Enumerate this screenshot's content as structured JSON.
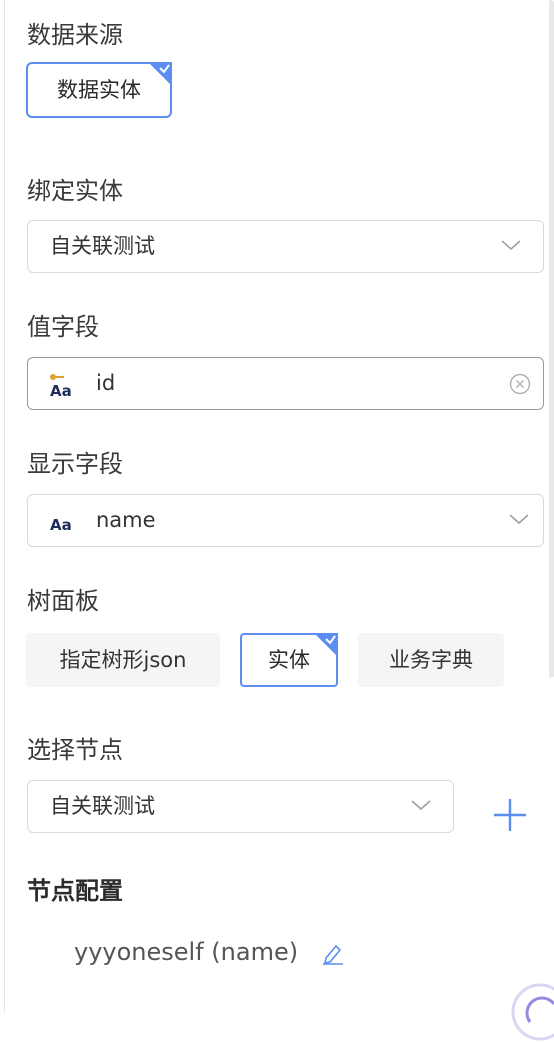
{
  "data_source": {
    "label": "数据来源",
    "option": "数据实体"
  },
  "bind_entity": {
    "label": "绑定实体",
    "value": "自关联测试"
  },
  "value_field": {
    "label": "值字段",
    "value": "id",
    "icon": "aa-key-icon"
  },
  "display_field": {
    "label": "显示字段",
    "value": "name",
    "icon": "aa-icon"
  },
  "tree_panel": {
    "label": "树面板",
    "options": [
      "指定树形json",
      "实体",
      "业务字典"
    ],
    "selected": "实体"
  },
  "select_node": {
    "label": "选择节点",
    "value": "自关联测试"
  },
  "node_config": {
    "label": "节点配置",
    "item": "yyyoneself (name)"
  },
  "colors": {
    "accent": "#5b8ef0",
    "border": "#d9d9d9",
    "chip_bg": "#f5f5f5"
  }
}
